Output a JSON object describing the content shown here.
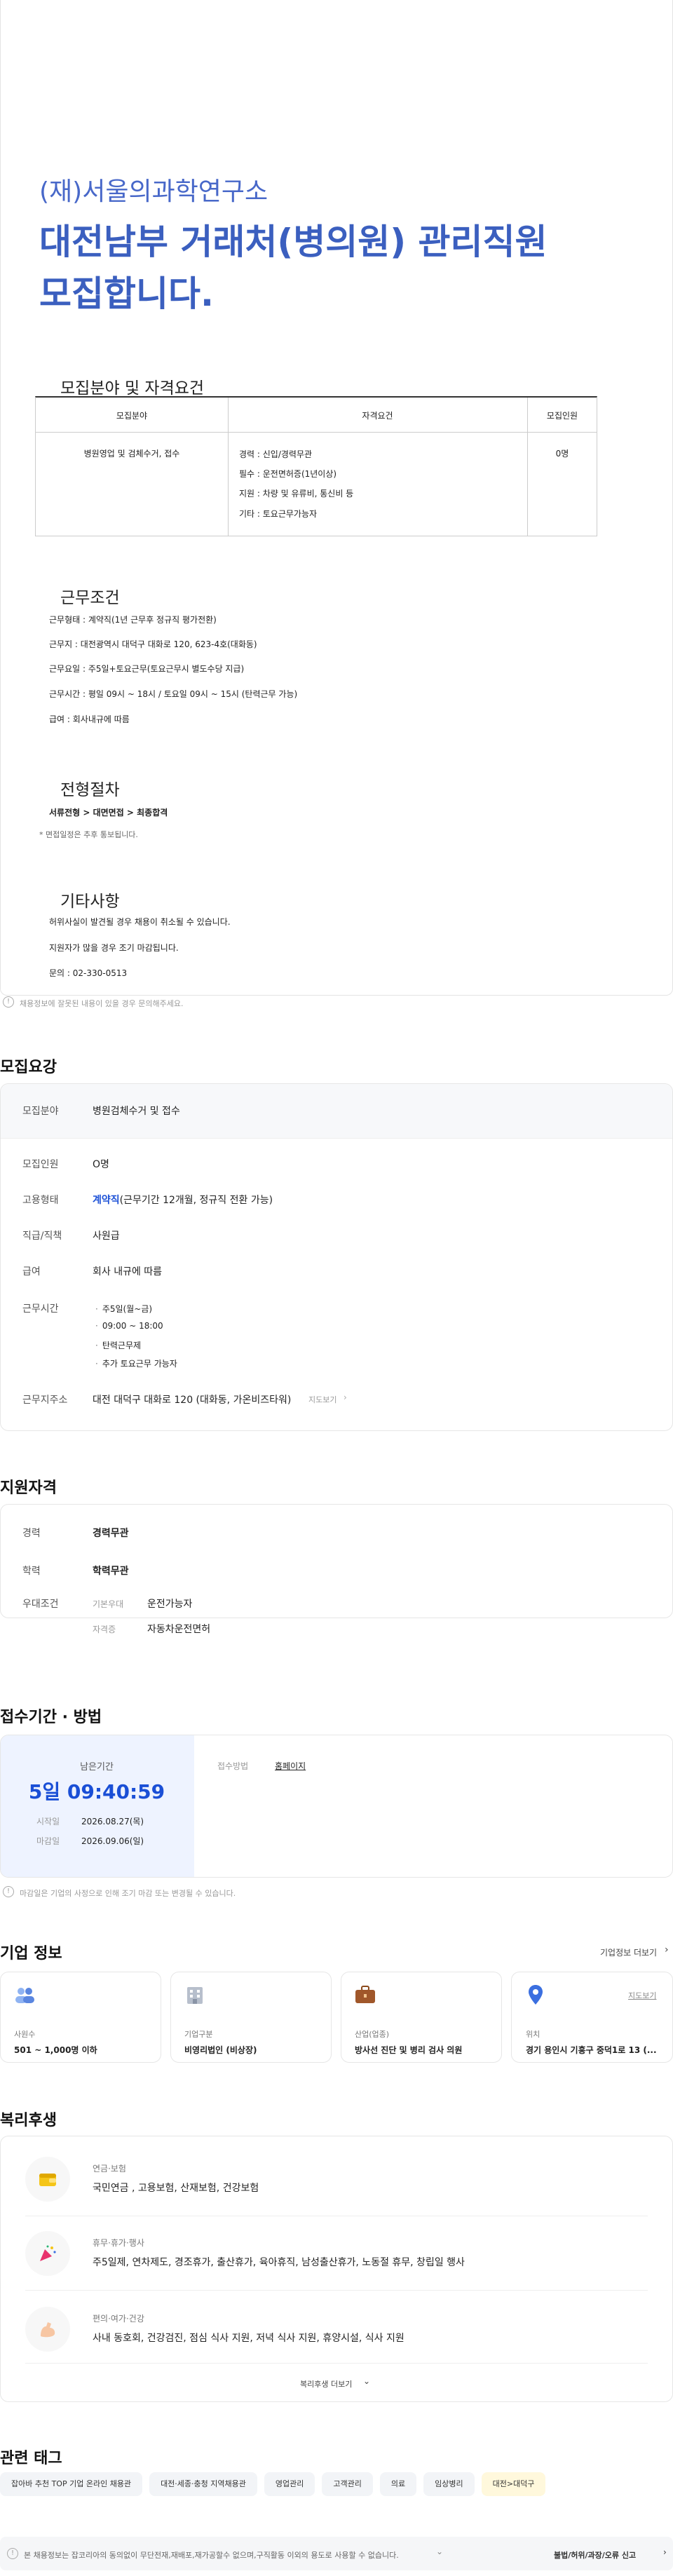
{
  "poster": {
    "company": "(재)서울의과학연구소",
    "title1": "대전남부 거래처(병의원) 관리직원",
    "title2": "모집합니다.",
    "sec1": "모집분야 및 자격요건",
    "th": [
      "모집분야",
      "자격요건",
      "모집인원"
    ],
    "field": "병원영업 및 검체수거, 접수",
    "quals": [
      "경력 : 신입/경력무관",
      "필수 : 운전면허증(1년이상)",
      "지원 : 차량 및 유류비, 통신비 등",
      "기타 : 토요근무가능자"
    ],
    "count": "0명",
    "sec2": "근무조건",
    "conds": [
      "근무형태 : 계약직(1년 근무후 정규직 평가전환)",
      "근무지 : 대전광역시 대덕구 대화로 120, 623-4호(대화동)",
      "근무요일 : 주5일+토요근무(토요근무시 별도수당 지급)",
      "근무시간 : 평일 09시 ~ 18시 / 토요일 09시 ~ 15시 (탄력근무 가능)",
      "급여 : 회사내규에 따름"
    ],
    "sec3": "전형절차",
    "process": "서류전형 > 대면면접 > 최종합격",
    "process_note": "* 면접일정은 추후 통보됩니다.",
    "sec4": "기타사항",
    "etc": [
      "허위사실이 발견될 경우 채용이 취소될 수 있습니다.",
      "지원자가 많을 경우 조기 마감됩니다.",
      "문의 : 02-330-0513"
    ]
  },
  "report_note": "채용정보에 잘못된 내용이 있을 경우 문의해주세요.",
  "summary": {
    "title": "모집요강",
    "rows": [
      {
        "label": "모집분야",
        "value": "병원검체수거 및 접수"
      },
      {
        "label": "모집인원",
        "value": "O명"
      },
      {
        "label": "고용형태",
        "emph": "계약직",
        "value": "(근무기간 12개월, 정규직 전환 가능)"
      },
      {
        "label": "직급/직책",
        "value": "사원급"
      },
      {
        "label": "급여",
        "value": "회사 내규에 따름"
      },
      {
        "label": "근무시간",
        "list": [
          "주5일(월~금)",
          "09:00 ~ 18:00",
          "탄력근무제",
          "추가 토요근무 가능자"
        ]
      },
      {
        "label": "근무지주소",
        "value": "대전 대덕구 대화로 120 (대화동, 가온비즈타워)",
        "link": "지도보기"
      }
    ]
  },
  "qual": {
    "title": "지원자격",
    "career_label": "경력",
    "career": "경력무관",
    "edu_label": "학력",
    "edu": "학력무관",
    "pref_label": "우대조건",
    "prefs": [
      {
        "k": "기본우대",
        "v": "운전가능자"
      },
      {
        "k": "자격증",
        "v": "자동차운전면허"
      }
    ]
  },
  "apply": {
    "title": "접수기간 · 방법",
    "remain_label": "남은기간",
    "remain": "5일 09:40:59",
    "start_label": "시작일",
    "start": "2026.08.27(목)",
    "end_label": "마감일",
    "end": "2026.09.06(일)",
    "method_label": "접수방법",
    "method": "홈페이지",
    "note": "마감일은 기업의 사정으로 인해 조기 마감 또는 변경될 수 있습니다."
  },
  "company": {
    "title": "기업 정보",
    "more": "기업정보 더보기",
    "cards": [
      {
        "label": "사원수",
        "value": "501 ~ 1,000명 이하",
        "icon": "people-icon"
      },
      {
        "label": "기업구분",
        "value": "비영리법인 (비상장)",
        "icon": "building-icon"
      },
      {
        "label": "산업(업종)",
        "value": "방사선 진단 및 병리 검사 의원",
        "icon": "briefcase-icon"
      },
      {
        "label": "위치",
        "value": "경기 용인시 기흥구 중덕1로 13 (...",
        "icon": "location-icon",
        "link": "지도보기"
      }
    ]
  },
  "welfare": {
    "title": "복리후생",
    "items": [
      {
        "cat": "연금·보험",
        "desc": "국민연금 , 고용보험, 산재보험, 건강보험"
      },
      {
        "cat": "휴무·휴가·행사",
        "desc": "주5일제, 연차제도, 경조휴가, 출산휴가, 육아휴직, 남성출산휴가, 노동절 휴무, 창립일 행사"
      },
      {
        "cat": "편의·여가·건강",
        "desc": "사내 동호회, 건강검진, 점심 식사 지원, 저녁 식사 지원, 휴양시설, 식사 지원"
      }
    ],
    "more": "복리후생 더보기"
  },
  "tags": {
    "title": "관련 태그",
    "items": [
      "잡아바 추천 TOP 기업 온라인 채용관",
      "대전·세종·충청 지역채용관",
      "영업관리",
      "고객관리",
      "의료",
      "임상병리",
      "대전>대덕구"
    ]
  },
  "footer": {
    "notice": "본 채용정보는 잡코리아의 동의없이 무단전재,재배포,재가공할수 없으며,구직활동 이외의 용도로 사용할 수 없습니다.",
    "report": "불법/허위/과장/오류 신고"
  },
  "colors": {
    "accent": "#1a4fd6",
    "poster_title": "#3b5fbf",
    "timer": "#1a4fd6"
  }
}
